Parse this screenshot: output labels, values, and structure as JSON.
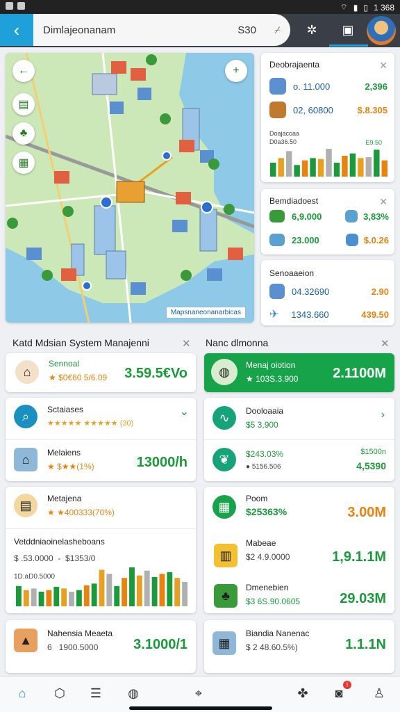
{
  "status": {
    "time": "1 368"
  },
  "topbar": {
    "search_text": "Dimlajeonanam",
    "search_value": "S30"
  },
  "map": {
    "label": "Mapsnaneonanarbicas"
  },
  "panel1": {
    "title": "Deobrajaenta",
    "rows": [
      {
        "a": "o. 11.000",
        "b": "2,396"
      },
      {
        "a": "02, 60800",
        "b": "$.8.305"
      }
    ],
    "chart_caption": "Doajacoaa\nD0a36.50     ",
    "chart_label": "E9.50",
    "chart_values": [
      30,
      40,
      55,
      25,
      35,
      40,
      38,
      60,
      30,
      45,
      50,
      40,
      42,
      58,
      35
    ]
  },
  "panel2": {
    "title": "Bemdiadoest",
    "rows": [
      {
        "a": "6,9.000",
        "b": "3,83%"
      },
      {
        "a": "23.000",
        "b": "$.0.26"
      }
    ]
  },
  "panel3": {
    "title": "Senoaaeion",
    "rows": [
      {
        "a": "04.32690",
        "b": "2.90"
      },
      {
        "a": "1343.660",
        "b": "439.50"
      }
    ]
  },
  "left_section": {
    "title": "Katd Mdsian System Manajenni",
    "cards": [
      {
        "name": "Sennoal",
        "sub": "$0€60 5/6.09",
        "value": "3.59.5€Vo"
      },
      {
        "name": "Sctaiases",
        "sub": "★★★★★ ★★★★★ (30)"
      },
      {
        "name": "Melaiens",
        "sub": "★ $★★(1%)",
        "value": "13000/h"
      },
      {
        "name": "Metajena",
        "sub": "★ ★400333(70%)"
      },
      {
        "name": "Vetddniaoinelasheboans",
        "sub": "$ .53.0000  -  $1353/0",
        "caption": "1D.aD0.5000"
      },
      {
        "name": "Nahensia Meaeta",
        "sub": "6   1900.5000",
        "value": "3.1000/1"
      }
    ],
    "bar_values": [
      25,
      20,
      22,
      18,
      20,
      24,
      22,
      18,
      20,
      26,
      28,
      45,
      40,
      25,
      35,
      48,
      38,
      44,
      36,
      40,
      42,
      35,
      30
    ]
  },
  "right_section": {
    "title": "Nanc dlmonna",
    "featured": {
      "name": "Menaj oiotion",
      "sub": "103S.3.900",
      "value": "2.1100M"
    },
    "cards": [
      {
        "name": "Dooloaaia",
        "sub": "$5 3,900"
      },
      {
        "name": "$243.03%",
        "sub": "● 5156.506",
        "value_top": "$1500n",
        "value": "4,5390"
      },
      {
        "name": "Poom",
        "sub": "$25363%",
        "value": "3.00M"
      },
      {
        "name": "Mabeae",
        "sub": "$2 4.9.0000",
        "value": "1,9.1.1M"
      },
      {
        "name": "Dmenebien",
        "sub": "$3 6S.90.0605",
        "value": "29.03M"
      },
      {
        "name": "Biandia Nanenac",
        "sub": "$ 2 48.60.5%)",
        "value": "1.1.1N"
      }
    ]
  },
  "nav": {
    "badge": "!"
  }
}
